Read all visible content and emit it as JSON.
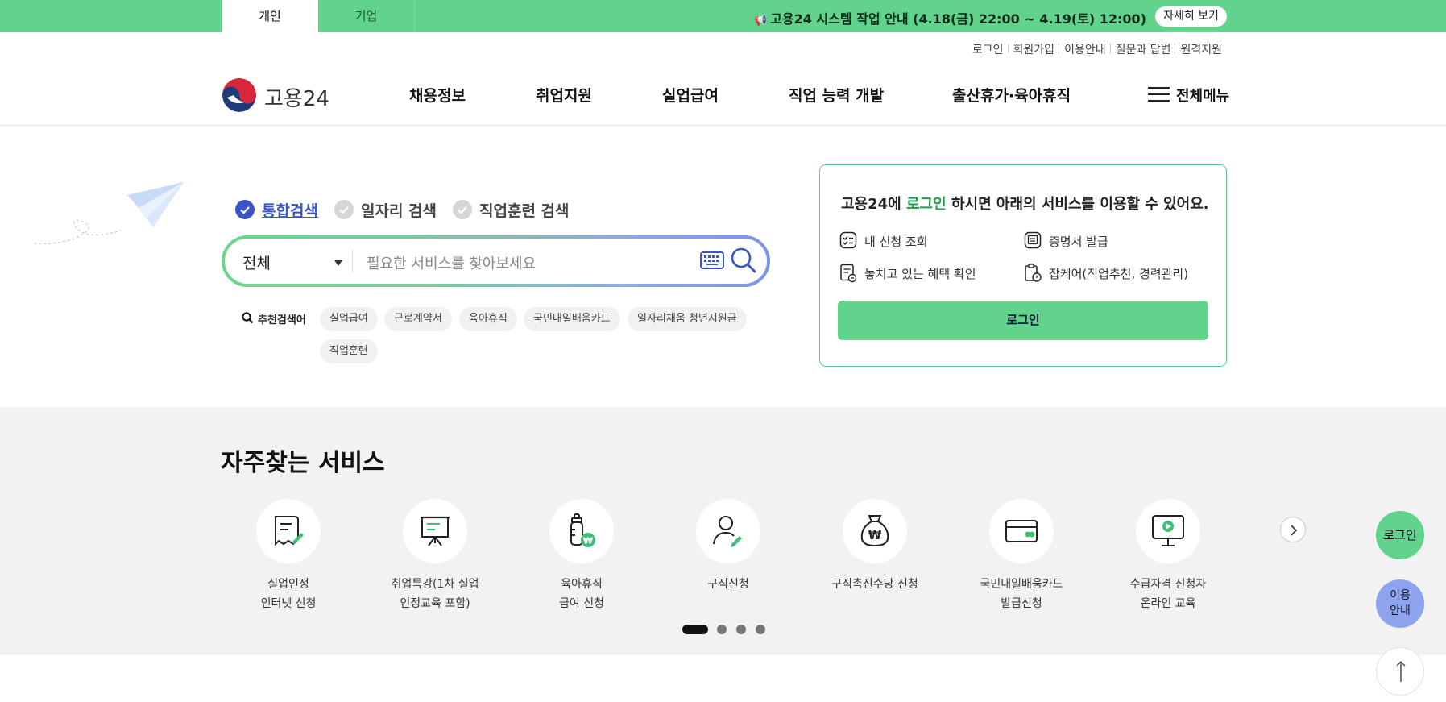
{
  "topbar": {
    "tabs": [
      "개인",
      "기업"
    ],
    "notice_text": "고용24 시스템 작업 안내 (4.18(금) 22:00 ~ 4.19(토) 12:00)",
    "notice_button": "자세히 보기"
  },
  "util_links": [
    "로그인",
    "회원가입",
    "이용안내",
    "질문과 답변",
    "원격지원"
  ],
  "header": {
    "logo_text": "고용24",
    "nav": [
      "채용정보",
      "취업지원",
      "실업급여",
      "직업 능력 개발",
      "출산휴가·육아휴직"
    ],
    "all_menu": "전체메뉴"
  },
  "search": {
    "tabs": [
      "통합검색",
      "일자리 검색",
      "직업훈련 검색"
    ],
    "select_value": "전체",
    "placeholder": "필요한 서비스를 찾아보세요",
    "recommend_label": "추천검색어",
    "keywords": [
      "실업급여",
      "근로계약서",
      "육아휴직",
      "국민내일배움카드",
      "일자리채움 청년지원금",
      "직업훈련"
    ]
  },
  "login_box": {
    "title_pre": "고용24에 ",
    "title_link": "로그인",
    "title_post": " 하시면 아래의 서비스를 이용할 수 있어요.",
    "items": [
      "내 신청 조회",
      "증명서 발급",
      "놓치고 있는 혜택 확인",
      "잡케어(직업추천, 경력관리)"
    ],
    "button": "로그인"
  },
  "services": {
    "title": "자주찾는 서비스",
    "items": [
      {
        "label": "실업인정\n인터넷 신청",
        "icon": "document-pen-icon"
      },
      {
        "label": "취업특강(1차 실업\n인정교육 포함)",
        "icon": "presentation-board-icon"
      },
      {
        "label": "육아휴직\n급여 신청",
        "icon": "baby-bottle-won-icon"
      },
      {
        "label": "구직신청",
        "icon": "person-pen-icon"
      },
      {
        "label": "구직촉진수당 신청",
        "icon": "money-bag-won-icon"
      },
      {
        "label": "국민내일배움카드\n발급신청",
        "icon": "card-icon"
      },
      {
        "label": "수급자격 신청자\n온라인 교육",
        "icon": "monitor-play-icon"
      }
    ],
    "pages": 4,
    "active_page": 1
  },
  "floating": {
    "login": "로그인",
    "guide_line1": "이용",
    "guide_line2": "안내"
  },
  "colors": {
    "brand_green": "#61d38c",
    "brand_blue": "#3a55c7",
    "guide_blue": "#8ea4ee"
  }
}
